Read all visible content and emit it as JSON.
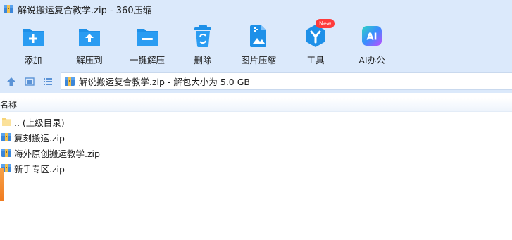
{
  "window": {
    "title": "解说搬运复合教学.zip - 360压缩"
  },
  "toolbar": {
    "items": [
      {
        "label": "添加",
        "icon": "add-folder-icon"
      },
      {
        "label": "解压到",
        "icon": "extract-to-icon"
      },
      {
        "label": "一键解压",
        "icon": "one-click-extract-icon"
      },
      {
        "label": "删除",
        "icon": "recycle-bin-icon"
      },
      {
        "label": "图片压缩",
        "icon": "image-compress-icon"
      },
      {
        "label": "工具",
        "icon": "tools-icon",
        "badge": "New"
      },
      {
        "label": "AI办公",
        "icon": "ai-office-icon",
        "icon_text": "AI"
      }
    ]
  },
  "address": {
    "text": "解说搬运复合教学.zip - 解包大小为 5.0 GB"
  },
  "columns": {
    "name": "名称"
  },
  "files": [
    {
      "name": ".. (上级目录)",
      "icon": "parent-folder-icon"
    },
    {
      "name": "复刻搬运.zip",
      "icon": "zip-archive-icon"
    },
    {
      "name": "海外原创搬运教学.zip",
      "icon": "zip-archive-icon"
    },
    {
      "name": "新手专区.zip",
      "icon": "zip-archive-icon"
    }
  ],
  "colors": {
    "toolbar_bg": "#dbe9fb",
    "icon_blue": "#1e90e8",
    "badge_red": "#ff3b3b"
  }
}
